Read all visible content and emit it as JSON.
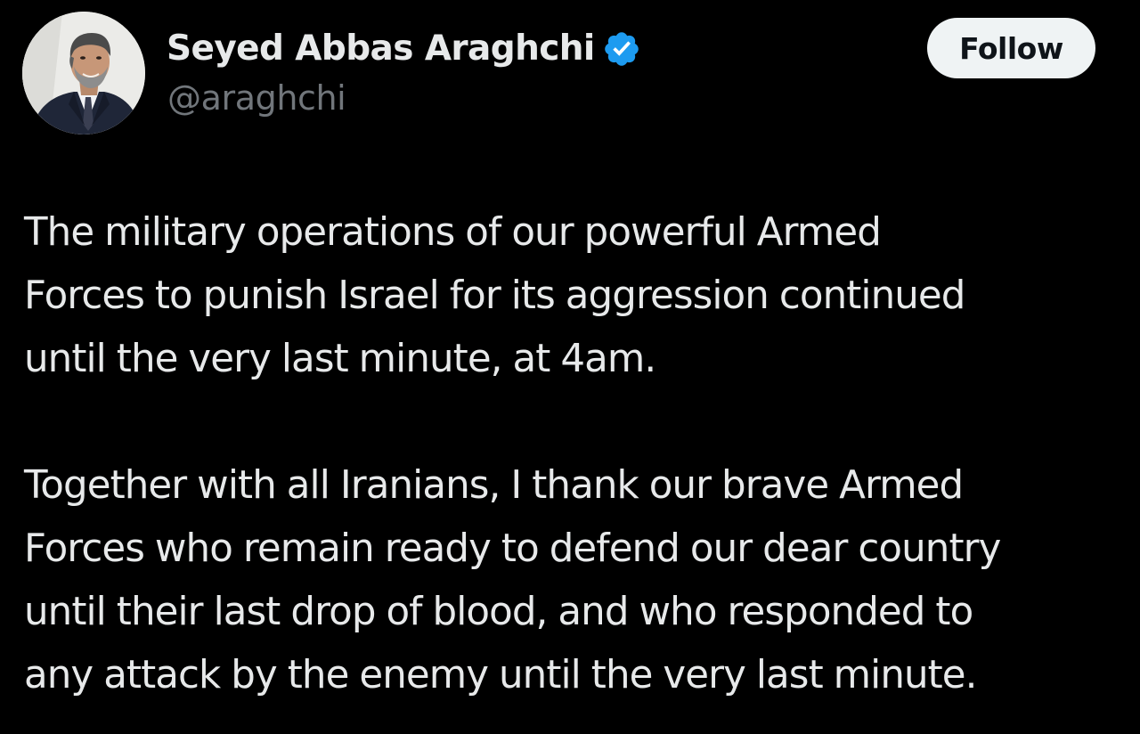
{
  "author": {
    "display_name": "Seyed Abbas Araghchi",
    "handle": "@araghchi",
    "verified": true,
    "verified_icon": "verified-badge-icon",
    "verified_color": "#1d9bf0",
    "avatar": "profile-photo"
  },
  "actions": {
    "follow_label": "Follow"
  },
  "tweet": {
    "paragraphs": [
      {
        "lines": [
          "The military operations of our powerful Armed",
          "Forces to punish Israel for its aggression continued",
          "until the very last minute, at 4am."
        ]
      },
      {
        "lines": [
          "Together with all Iranians, I thank our brave Armed",
          "Forces who remain ready to defend our dear country",
          "until their last drop of blood, and who responded to",
          "any attack by the enemy until the very last minute."
        ]
      }
    ]
  },
  "colors": {
    "background": "#000000",
    "text": "#e7e9ea",
    "secondary_text": "#71767b",
    "button_bg": "#eff3f4",
    "button_text": "#0f1419"
  }
}
